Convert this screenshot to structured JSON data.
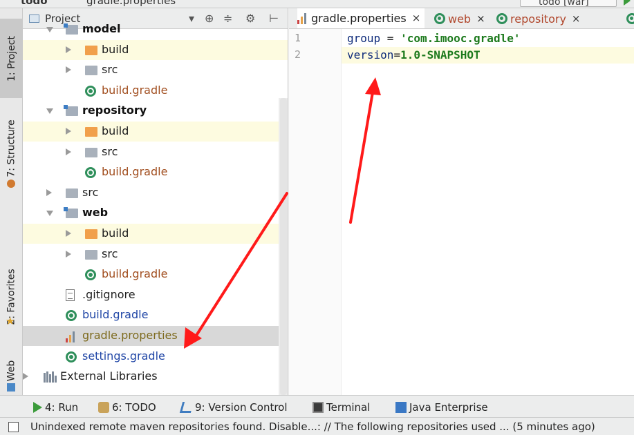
{
  "topbar": {
    "project_name": "todo",
    "breadcrumb_file": "gradle.properties",
    "run_config": "todo [war]"
  },
  "left_strip": {
    "project_tab": "1: Project",
    "structure_tab": "7: Structure",
    "favorites_tab": "2: Favorites",
    "web_tab": "Web"
  },
  "project_panel": {
    "title": "Project",
    "tree": [
      {
        "label": "model",
        "kind": "module",
        "indent": 0,
        "expanded": true,
        "style": "bold"
      },
      {
        "label": "build",
        "kind": "build",
        "indent": 1,
        "expanded": false,
        "style": "normal",
        "highlight": true
      },
      {
        "label": "src",
        "kind": "src",
        "indent": 1,
        "expanded": false,
        "style": "normal"
      },
      {
        "label": "build.gradle",
        "kind": "gradle",
        "indent": 1,
        "style": "orange"
      },
      {
        "label": "repository",
        "kind": "module",
        "indent": 0,
        "expanded": true,
        "style": "bold"
      },
      {
        "label": "build",
        "kind": "build",
        "indent": 1,
        "expanded": false,
        "style": "normal",
        "highlight": true
      },
      {
        "label": "src",
        "kind": "src",
        "indent": 1,
        "expanded": false,
        "style": "normal"
      },
      {
        "label": "build.gradle",
        "kind": "gradle",
        "indent": 1,
        "style": "orange"
      },
      {
        "label": "src",
        "kind": "src",
        "indent": 0,
        "expanded": false,
        "style": "normal"
      },
      {
        "label": "web",
        "kind": "module",
        "indent": 0,
        "expanded": true,
        "style": "bold"
      },
      {
        "label": "build",
        "kind": "build",
        "indent": 1,
        "expanded": false,
        "style": "normal",
        "highlight": true
      },
      {
        "label": "src",
        "kind": "src",
        "indent": 1,
        "expanded": false,
        "style": "normal"
      },
      {
        "label": "build.gradle",
        "kind": "gradle",
        "indent": 1,
        "style": "orange"
      },
      {
        "label": ".gitignore",
        "kind": "text",
        "indent": 0,
        "style": "normal"
      },
      {
        "label": "build.gradle",
        "kind": "gradle",
        "indent": 0,
        "style": "blue"
      },
      {
        "label": "gradle.properties",
        "kind": "properties",
        "indent": 0,
        "style": "olive",
        "selected": true
      },
      {
        "label": "settings.gradle",
        "kind": "gradle",
        "indent": 0,
        "style": "blue"
      },
      {
        "label": "External Libraries",
        "kind": "libs",
        "indent": -1,
        "expanded": false,
        "style": "normal"
      }
    ]
  },
  "editor": {
    "tabs": [
      {
        "label": "gradle.properties",
        "active": true,
        "icon": "properties-icon"
      },
      {
        "label": "web",
        "active": false,
        "icon": "gradle-icon"
      },
      {
        "label": "repository",
        "active": false,
        "icon": "gradle-icon"
      }
    ],
    "line_numbers": [
      "1",
      "2"
    ],
    "code": {
      "line1_key": "group",
      "line1_eq": " = ",
      "line1_value": "'com.imooc.gradle'",
      "line2_key": "version",
      "line2_eq": "=",
      "line2_value": "1.0-SNAPSHOT"
    }
  },
  "bottom_tools": [
    {
      "label": "4: Run",
      "icon": "run-icon"
    },
    {
      "label": "6: TODO",
      "icon": "todo-icon"
    },
    {
      "label": "9: Version Control",
      "icon": "vcs-icon"
    },
    {
      "label": "Terminal",
      "icon": "terminal-icon"
    },
    {
      "label": "Java Enterprise",
      "icon": "java-enterprise-icon"
    }
  ],
  "status": {
    "message": "Unindexed remote maven repositories found. Disable...: // The following repositories used ... (5 minutes ago)"
  },
  "colors": {
    "annotation_arrow": "#ff1a1a",
    "gradle_green": "#2f8f5b",
    "highlight_row": "#fdfbe0",
    "selected_row": "#d8d8d8"
  }
}
